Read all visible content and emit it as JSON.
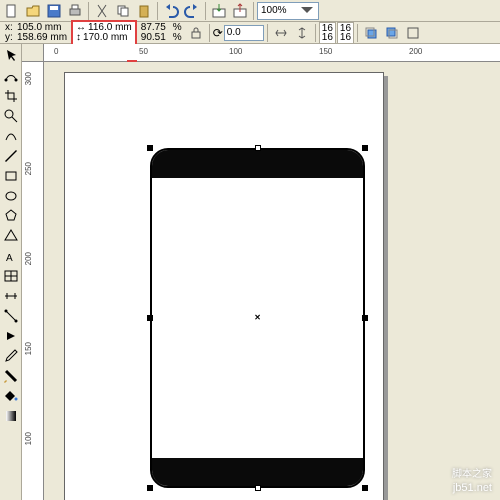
{
  "toolbar1": {
    "zoom": "100%"
  },
  "toolbar2": {
    "x_label": "x:",
    "y_label": "y:",
    "x_value": "105.0 mm",
    "y_value": "158.69 mm",
    "width_value": "116.0 mm",
    "height_value": "170.0 mm",
    "scale_x": "87.75",
    "scale_y": "90.51",
    "pct": "%",
    "rotation": "0.0",
    "nudge1": "16",
    "nudge2": "16",
    "nudge3": "16",
    "nudge4": "16"
  },
  "rulers": {
    "h": [
      "0",
      "50",
      "100",
      "150",
      "200"
    ],
    "v": [
      "300",
      "250",
      "200",
      "150",
      "100"
    ]
  },
  "watermark": {
    "main": "脚本之家",
    "sub": "jb51.net"
  }
}
